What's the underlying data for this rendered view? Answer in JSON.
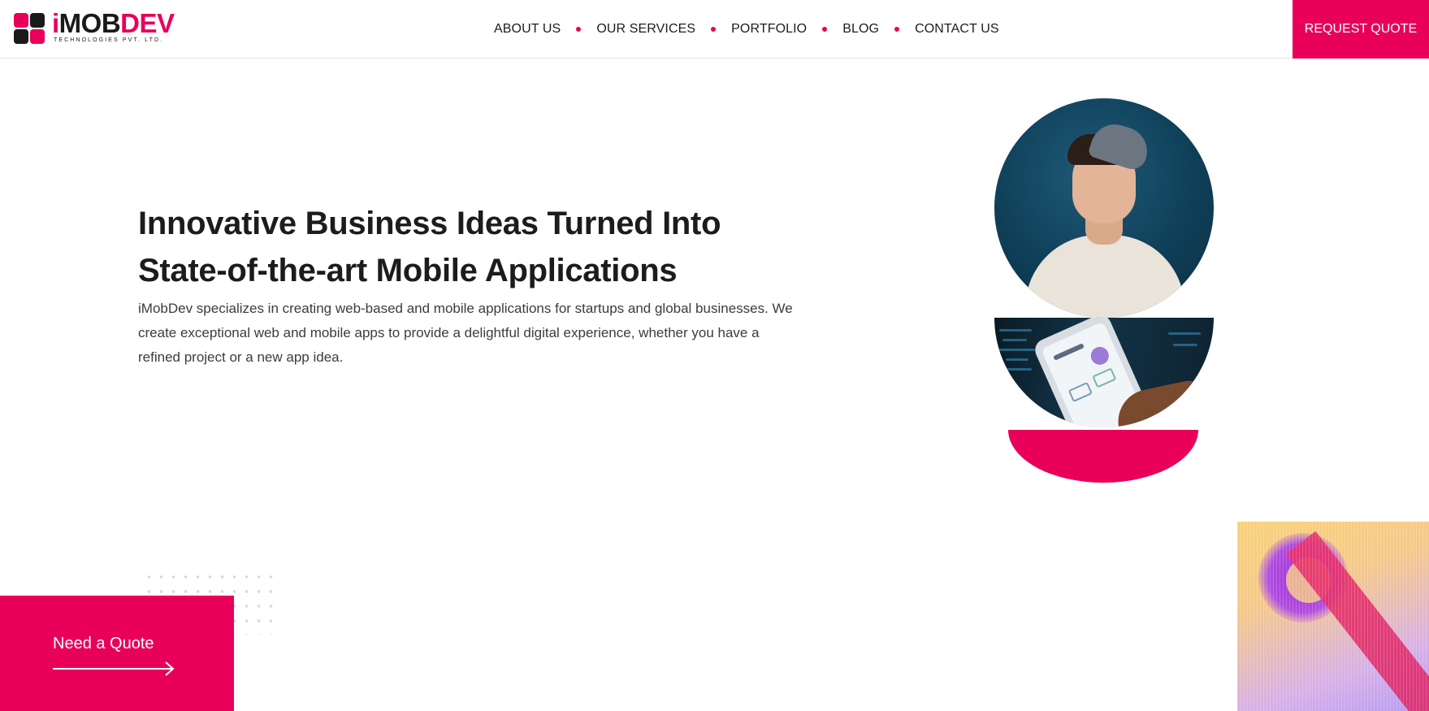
{
  "brand": {
    "logo_part1": "i",
    "logo_part2": "MOB",
    "logo_part3": "DEV",
    "logo_subtitle": "TECHNOLOGIES PVT. LTD.",
    "accent_color": "#e8005a",
    "dark_color": "#1a1a1a"
  },
  "nav": {
    "items": [
      {
        "label": "ABOUT US"
      },
      {
        "label": "OUR SERVICES"
      },
      {
        "label": "PORTFOLIO"
      },
      {
        "label": "BLOG"
      },
      {
        "label": "CONTACT US"
      }
    ],
    "cta_label": "REQUEST QUOTE"
  },
  "hero": {
    "title_line1": "Innovative Business Ideas Turned Into",
    "title_line2": "State-of-the-art Mobile Applications",
    "description": "iMobDev specializes in creating web-based and mobile applications for startups and global businesses. We create exceptional web and mobile apps to provide a delightful digital experience, whether you have a refined project or a new app idea."
  },
  "quote_card": {
    "label": "Need a Quote",
    "icon": "arrow-right-icon"
  }
}
